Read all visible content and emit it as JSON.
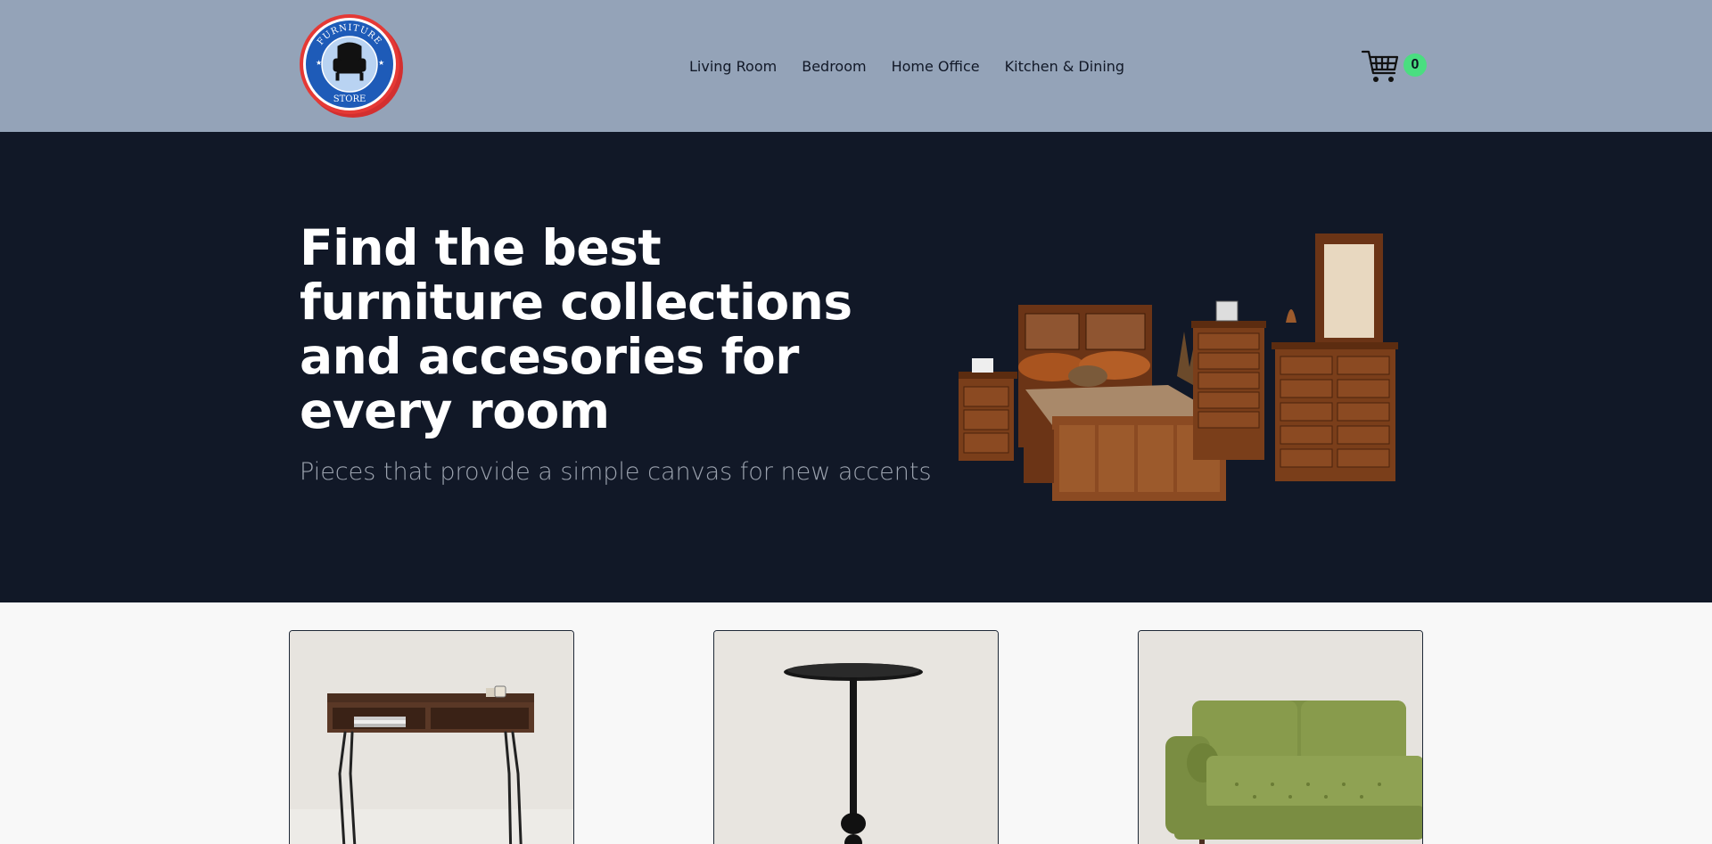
{
  "logo": {
    "top_text": "FURNITURE",
    "bottom_text": "STORE"
  },
  "nav": {
    "items": [
      "Living Room",
      "Bedroom",
      "Home Office",
      "Kitchen & Dining"
    ]
  },
  "cart": {
    "count": "0",
    "icon": "cart-icon"
  },
  "hero": {
    "title": "Find the best furniture collections and accesories for every room",
    "subtitle": "Pieces that provide a simple canvas for new accents"
  },
  "products": [
    {
      "image": "desk"
    },
    {
      "image": "side-table"
    },
    {
      "image": "green-sofa"
    }
  ],
  "colors": {
    "header_bg": "#94a3b8",
    "hero_bg": "#111827",
    "cart_badge": "#4ade80",
    "logo_blue": "#1e5bb8",
    "logo_red": "#d32f2f"
  }
}
